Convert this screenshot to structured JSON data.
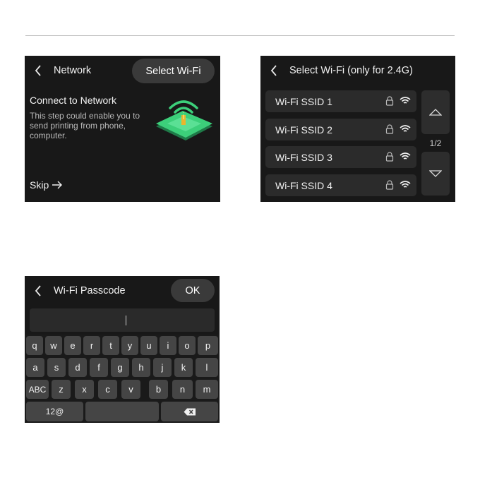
{
  "network_screen": {
    "back_icon": "chevron-left-icon",
    "title": "Network",
    "select_wifi_button": "Select Wi-Fi",
    "heading": "Connect to Network",
    "description": "This step could enable you to send printing from phone, computer.",
    "skip_label": "Skip",
    "skip_icon": "arrow-right-icon",
    "illustration_icon": "wifi-printer-illustration",
    "accent_color": "#3ccf7a"
  },
  "wifi_list_screen": {
    "back_icon": "chevron-left-icon",
    "title": "Select Wi-Fi (only for 2.4G)",
    "networks": [
      {
        "ssid": "Wi-Fi SSID 1",
        "locked": true,
        "signal": "full"
      },
      {
        "ssid": "Wi-Fi SSID 2",
        "locked": true,
        "signal": "full"
      },
      {
        "ssid": "Wi-Fi SSID 3",
        "locked": true,
        "signal": "full"
      },
      {
        "ssid": "Wi-Fi SSID 4",
        "locked": true,
        "signal": "full"
      }
    ],
    "page_indicator": "1/2",
    "page_up_icon": "triangle-up-icon",
    "page_down_icon": "triangle-down-icon"
  },
  "passcode_screen": {
    "back_icon": "chevron-left-icon",
    "title": "Wi-Fi Passcode",
    "ok_button": "OK",
    "input_value": "",
    "keyboard": {
      "row1": [
        "q",
        "w",
        "e",
        "r",
        "t",
        "y",
        "u",
        "i",
        "o",
        "p"
      ],
      "row2": [
        "a",
        "s",
        "d",
        "f",
        "g",
        "h",
        "j",
        "k",
        "l"
      ],
      "row3": [
        "ABC",
        "z",
        "x",
        "c",
        "v",
        "b",
        "n",
        "m"
      ],
      "mode_key": "12@",
      "space_key": "",
      "backspace_icon": "backspace-icon"
    }
  }
}
